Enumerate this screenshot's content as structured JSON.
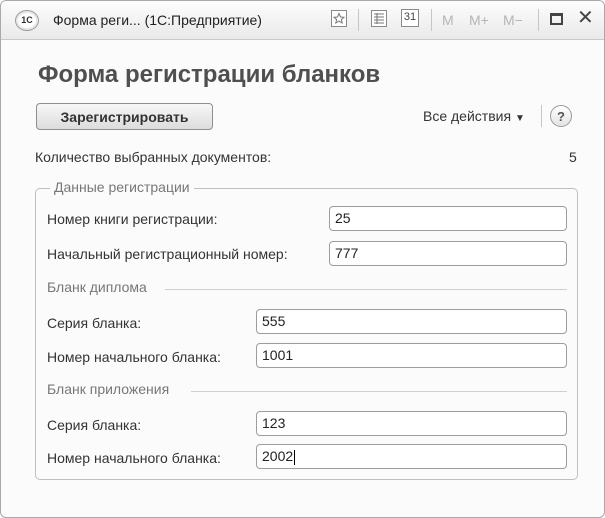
{
  "window": {
    "logo_text": "1С",
    "title": "Форма реги... (1С:Предприятие)",
    "tool_icons": [
      "favorite-icon",
      "list-icon",
      "calendar-icon"
    ],
    "calendar_text": "31",
    "m_buttons": [
      "M",
      "M+",
      "M−"
    ]
  },
  "form": {
    "title": "Форма регистрации бланков",
    "register_button": "Зарегистрировать",
    "all_actions": "Все действия",
    "help": "?",
    "selected_docs_label": "Количество выбранных документов:",
    "selected_docs_value": "5"
  },
  "registration": {
    "legend": "Данные регистрации",
    "book_number_label": "Номер книги регистрации:",
    "book_number_value": "25",
    "start_reg_number_label": "Начальный регистрационный номер:",
    "start_reg_number_value": "777"
  },
  "diploma": {
    "heading": "Бланк диплома",
    "series_label": "Серия бланка:",
    "series_value": "555",
    "start_number_label": "Номер начального бланка:",
    "start_number_value": "1001"
  },
  "appendix": {
    "heading": "Бланк приложения",
    "series_label": "Серия бланка:",
    "series_value": "123",
    "start_number_label": "Номер начального бланка:",
    "start_number_value": "2002"
  }
}
